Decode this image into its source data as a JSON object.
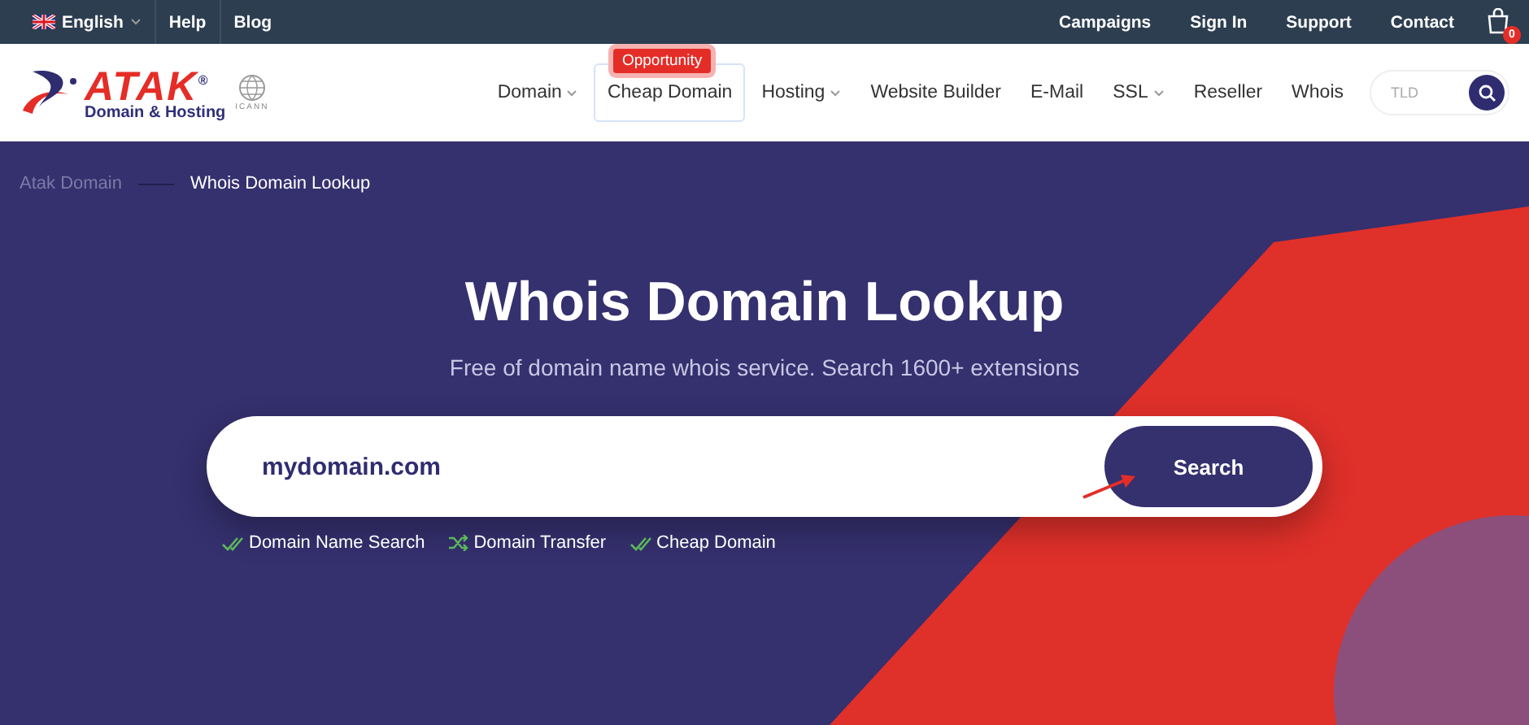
{
  "top_bar": {
    "left": [
      {
        "label": "English",
        "kind": "language"
      },
      {
        "label": "Help",
        "kind": "link"
      },
      {
        "label": "Blog",
        "kind": "link"
      }
    ],
    "right": [
      "Campaigns",
      "Sign In",
      "Support",
      "Contact"
    ],
    "cart_count": "0"
  },
  "logo": {
    "name": "ATAK",
    "mark": "®",
    "tagline": "Domain & Hosting",
    "accreditation": "ICANN"
  },
  "nav": [
    {
      "label": "Domain",
      "dropdown": true
    },
    {
      "label": "Cheap Domain",
      "dropdown": false,
      "badge": "Opportunity"
    },
    {
      "label": "Hosting",
      "dropdown": true
    },
    {
      "label": "Website Builder",
      "dropdown": false
    },
    {
      "label": "E-Mail",
      "dropdown": false
    },
    {
      "label": "SSL",
      "dropdown": true
    },
    {
      "label": "Reseller",
      "dropdown": false
    },
    {
      "label": "Whois",
      "dropdown": false
    }
  ],
  "tld_search": {
    "placeholder": "TLD"
  },
  "breadcrumb": [
    {
      "label": "Atak Domain",
      "current": false
    },
    {
      "label": "Whois Domain Lookup",
      "current": true
    }
  ],
  "hero": {
    "title": "Whois Domain Lookup",
    "subtitle": "Free of domain name whois service. Search 1600+ extensions",
    "search_value": "mydomain.com",
    "button": "Search",
    "features": [
      {
        "label": "Domain Name Search",
        "kind": "check"
      },
      {
        "label": "Domain Transfer",
        "kind": "shuffle"
      },
      {
        "label": "Cheap Domain",
        "kind": "check"
      }
    ]
  }
}
